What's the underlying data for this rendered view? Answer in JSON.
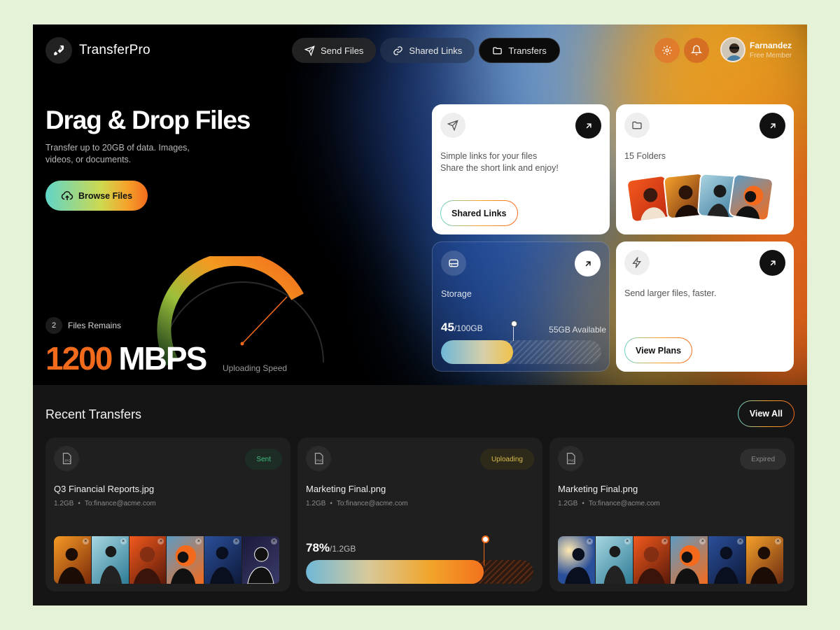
{
  "app": {
    "name": "TransferPro"
  },
  "nav": [
    {
      "label": "Send Files",
      "icon": "send-icon"
    },
    {
      "label": "Shared Links",
      "icon": "link-icon"
    },
    {
      "label": "Transfers",
      "icon": "folder-icon"
    }
  ],
  "user": {
    "name": "Farnandez",
    "role": "Free Member"
  },
  "hero": {
    "title": "Drag & Drop Files",
    "subtitle": "Transfer up to 20GB of data. Images, videos, or documents.",
    "browse_label": "Browse Files",
    "files_remaining": "2",
    "files_remaining_label": "Files Remains",
    "speed_value": "1200",
    "speed_unit": "MBPS",
    "speed_label": "Uploading Speed"
  },
  "cards": {
    "shared": {
      "line1": "Simple links for your files",
      "line2": "Share the short link and enjoy!",
      "button": "Shared Links"
    },
    "folders": {
      "label": "15 Folders"
    },
    "storage": {
      "label": "Storage",
      "used": "45",
      "total": "/100GB",
      "available": "55GB Available",
      "used_fraction": 0.45
    },
    "plans": {
      "label": "Send larger files, faster.",
      "button": "View Plans"
    }
  },
  "recent": {
    "title": "Recent Transfers",
    "view_all": "View All",
    "items": [
      {
        "type": "JPG",
        "status": "Sent",
        "name": "Q3 Financial Reports.jpg",
        "size": "1.2GB",
        "to": "To:finance@acme.com"
      },
      {
        "type": "PNG",
        "status": "Uploading",
        "name": "Marketing Final.png",
        "size": "1.2GB",
        "to": "To:finance@acme.com",
        "progress": "78%",
        "progress_total": "/1.2GB",
        "progress_fraction": 0.78
      },
      {
        "type": "PNG",
        "status": "Expired",
        "name": "Marketing Final.png",
        "size": "1.2GB",
        "to": "To:finance@acme.com"
      }
    ]
  },
  "colors": {
    "accent": "#f26b1d",
    "teal": "#5fd6c9",
    "sent": "#3fbf7f",
    "uploading": "#d7b94a"
  }
}
